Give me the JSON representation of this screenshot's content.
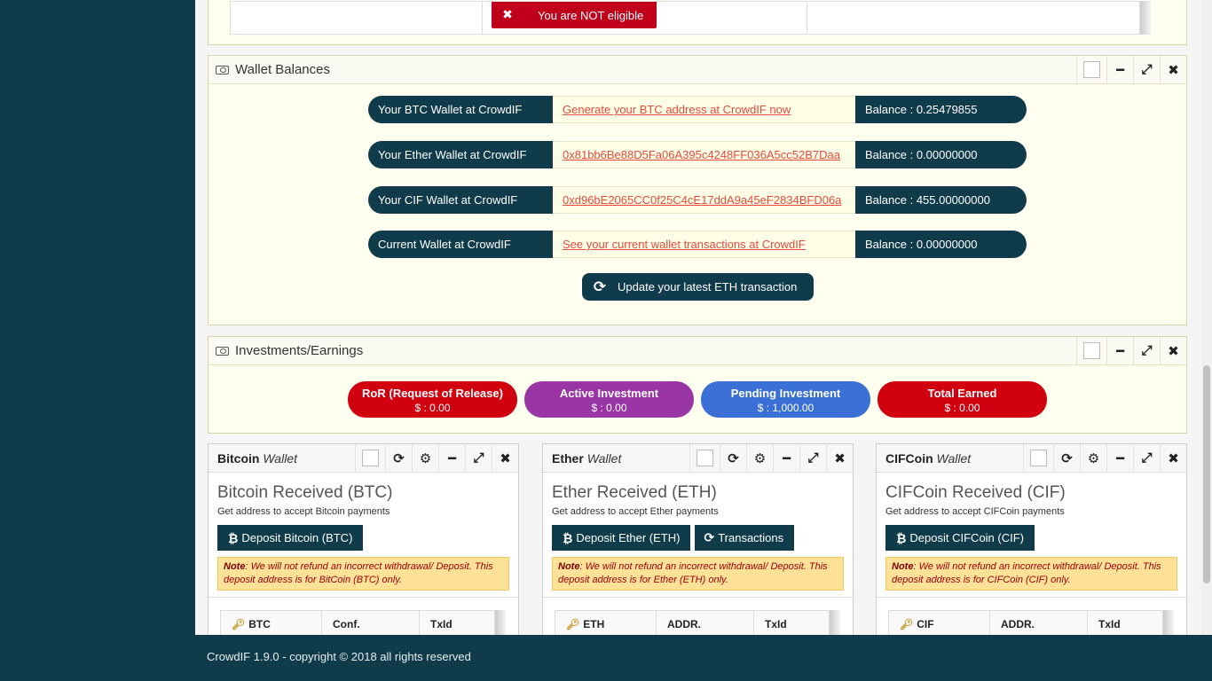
{
  "top_table": {
    "not_eligible_label": "You are NOT eligible"
  },
  "wallet_balances": {
    "title": "Wallet Balances",
    "rows": [
      {
        "label": "Your BTC Wallet at CrowdIF",
        "link": "Generate your BTC address at CrowdIF now",
        "balance": "Balance : 0.25479855"
      },
      {
        "label": "Your Ether Wallet at CrowdIF",
        "link": "0x81bb6Be88D5Fa06A395c4248FF036A5cc52B7Daa",
        "balance": "Balance : 0.00000000"
      },
      {
        "label": "Your CIF Wallet at CrowdIF",
        "link": "0xd96bE2065CC0f25C4cE17ddA9a45eF2834BFD06a",
        "balance": "Balance : 455.00000000"
      },
      {
        "label": "Current Wallet at CrowdIF",
        "link": "See your current wallet transactions at CrowdIF",
        "balance": "Balance : 0.00000000"
      }
    ],
    "update_button": "Update your latest ETH transaction"
  },
  "investments": {
    "title": "Investments/Earnings",
    "pills": [
      {
        "heading": "RoR (Request of Release)",
        "value": "$ : 0.00",
        "color": "#d0000f"
      },
      {
        "heading": "Active Investment",
        "value": "$ : 0.00",
        "color": "#9a35a6"
      },
      {
        "heading": "Pending Investment",
        "value": "$ : 1,000.00",
        "color": "#3a6fd6"
      },
      {
        "heading": "Total Earned",
        "value": "$ : 0.00",
        "color": "#d0000f"
      }
    ]
  },
  "coins": [
    {
      "title_bold": "Bitcoin",
      "title_italic": "Wallet",
      "heading": "Bitcoin Received (BTC)",
      "sub": "Get address to accept Bitcoin payments",
      "buttons": [
        "Deposit Bitcoin (BTC)"
      ],
      "note_label": "Note",
      "note": ": We will not refund an incorrect withdrawal/ Deposit. This deposit address is for BitCoin (BTC) only.",
      "columns": [
        "BTC",
        "Conf.",
        "TxId"
      ]
    },
    {
      "title_bold": "Ether",
      "title_italic": "Wallet",
      "heading": "Ether Received (ETH)",
      "sub": "Get address to accept Ether payments",
      "buttons": [
        "Deposit Ether (ETH)",
        "Transactions"
      ],
      "note_label": "Note",
      "note": ": We will not refund an incorrect withdrawal/ Deposit. This deposit address is for Ether (ETH) only.",
      "columns": [
        "ETH",
        "ADDR.",
        "TxId"
      ]
    },
    {
      "title_bold": "CIFCoin",
      "title_italic": "Wallet",
      "heading": "CIFCoin Received (CIF)",
      "sub": "Get address to accept CIFCoin payments",
      "buttons": [
        "Deposit CIFCoin (CIF)"
      ],
      "note_label": "Note",
      "note": ": We will not refund an incorrect withdrawal/ Deposit. This deposit address is for CIFCoin (CIF) only.",
      "columns": [
        "CIF",
        "ADDR.",
        "TxId"
      ]
    }
  ],
  "footer": {
    "text": "CrowdIF 1.9.0 - copyright © 2018 all rights reserved"
  },
  "colors": {
    "brand": "#0f3b4b",
    "link": "#e8493c",
    "note_bg": "#ffe198"
  }
}
